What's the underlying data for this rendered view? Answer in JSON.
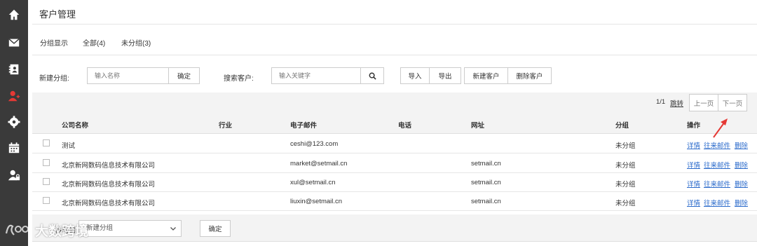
{
  "page_title": "客户管理",
  "tabs": [
    {
      "label": "分组显示"
    },
    {
      "label": "全部(4)"
    },
    {
      "label": "未分组(3)"
    }
  ],
  "toolbar": {
    "new_group_label": "新建分组:",
    "new_group_placeholder": "输入名称",
    "confirm_label": "确定",
    "search_label": "搜索客户:",
    "search_placeholder": "输入关键字",
    "import_label": "导入",
    "export_label": "导出",
    "new_customer_label": "新建客户",
    "delete_customer_label": "删除客户"
  },
  "pager": {
    "page_info": "1/1",
    "jump_label": "跳转",
    "prev_label": "上一页",
    "next_label": "下一页"
  },
  "table": {
    "headers": {
      "company": "公司名称",
      "industry": "行业",
      "email": "电子邮件",
      "phone": "电话",
      "website": "网址",
      "group": "分组",
      "actions": "操作"
    },
    "rows": [
      {
        "company": "测试",
        "industry": "",
        "email": "ceshi@123.com",
        "phone": "",
        "website": "",
        "group": "未分组"
      },
      {
        "company": "北京新网数码信息技术有限公司",
        "industry": "",
        "email": "market@setmail.cn",
        "phone": "",
        "website": "setmail.cn",
        "group": "未分组"
      },
      {
        "company": "北京新网数码信息技术有限公司",
        "industry": "",
        "email": "xul@setmail.cn",
        "phone": "",
        "website": "setmail.cn",
        "group": "未分组"
      },
      {
        "company": "北京新网数码信息技术有限公司",
        "industry": "",
        "email": "liuxin@setmail.cn",
        "phone": "",
        "website": "setmail.cn",
        "group": "未分组"
      }
    ],
    "action_labels": {
      "detail": "详情",
      "mail": "往来邮件",
      "delete": "删除"
    }
  },
  "footer": {
    "move_to_label": "移动到",
    "select_value": "新建分组",
    "confirm_label": "确定"
  },
  "watermark": "大数跨境",
  "colors": {
    "sidebar": "#3a3a3a",
    "link": "#2a6acb",
    "arrow": "#e53935",
    "active_icon": "#e53935"
  }
}
